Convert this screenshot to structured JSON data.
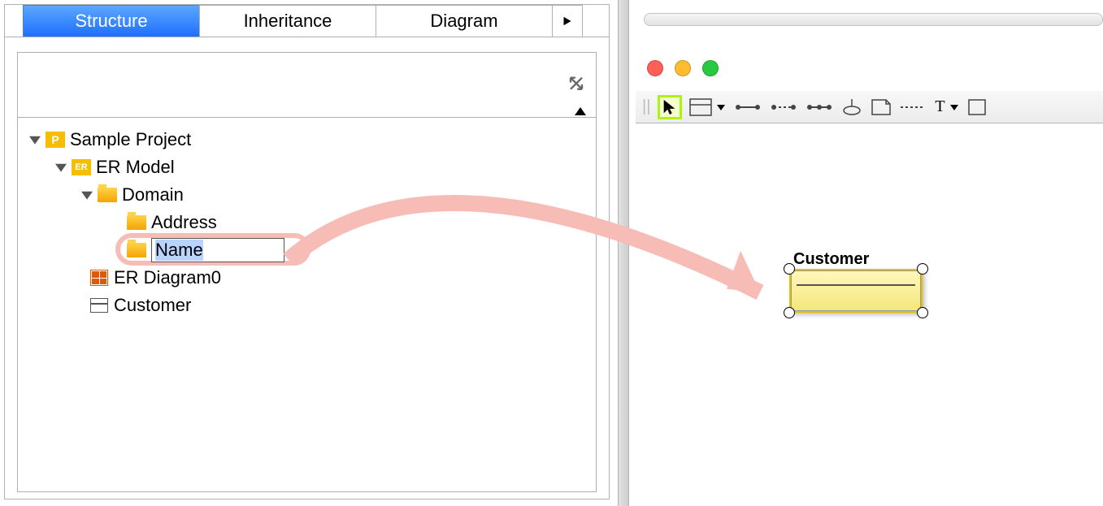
{
  "tabs": {
    "structure": "Structure",
    "inheritance": "Inheritance",
    "diagram": "Diagram"
  },
  "tree": {
    "root": "Sample Project",
    "er_model": "ER Model",
    "domain": "Domain",
    "address": "Address",
    "name_edit": "Name",
    "er_diagram0": "ER Diagram0",
    "customer": "Customer"
  },
  "canvas": {
    "entity_label": "Customer"
  },
  "icons": {
    "p_badge": "P",
    "er_badge": "ER"
  }
}
